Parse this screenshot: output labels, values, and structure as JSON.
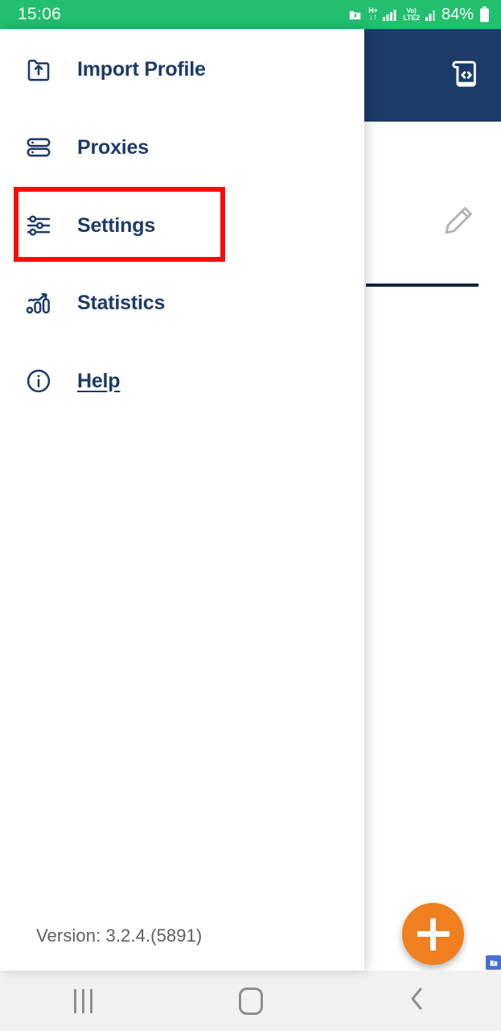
{
  "status_bar": {
    "time": "15:06",
    "battery_percent": "84%",
    "network_type_top": "H+",
    "network_type_bottom": "↓↑",
    "volte_top": "Vo)",
    "volte_bottom": "LTE2",
    "icons": [
      "folder-upload-icon",
      "data-transfer-icon",
      "signal-bars-icon",
      "volte-icon",
      "signal-bars-2-icon",
      "battery-icon"
    ],
    "background_color": "#21bf6e"
  },
  "drawer": {
    "items": [
      {
        "label": "Import Profile",
        "icon": "folder-upload-icon",
        "is_link": false
      },
      {
        "label": "Proxies",
        "icon": "server-stack-icon",
        "is_link": false
      },
      {
        "label": "Settings",
        "icon": "sliders-icon",
        "is_link": false
      },
      {
        "label": "Statistics",
        "icon": "chart-trending-up-icon",
        "is_link": false
      },
      {
        "label": "Help",
        "icon": "info-circle-icon",
        "is_link": true
      }
    ],
    "version_label": "Version: 3.2.4.(5891)",
    "text_color": "#1d3b69"
  },
  "annotation": {
    "target": "Settings",
    "color": "#fb0a0a"
  },
  "app_background": {
    "header_color": "#1d3b69",
    "header_icon": "script-code-icon",
    "edit_icon": "pencil-icon",
    "fab_icon": "plus-icon",
    "fab_color": "#ef7f1f"
  },
  "system_nav": {
    "buttons": [
      {
        "name": "recents-button",
        "icon": "recents-icon"
      },
      {
        "name": "home-button",
        "icon": "home-icon"
      },
      {
        "name": "back-button",
        "icon": "back-chevron-icon"
      }
    ],
    "background_color": "#f1f1f1"
  }
}
